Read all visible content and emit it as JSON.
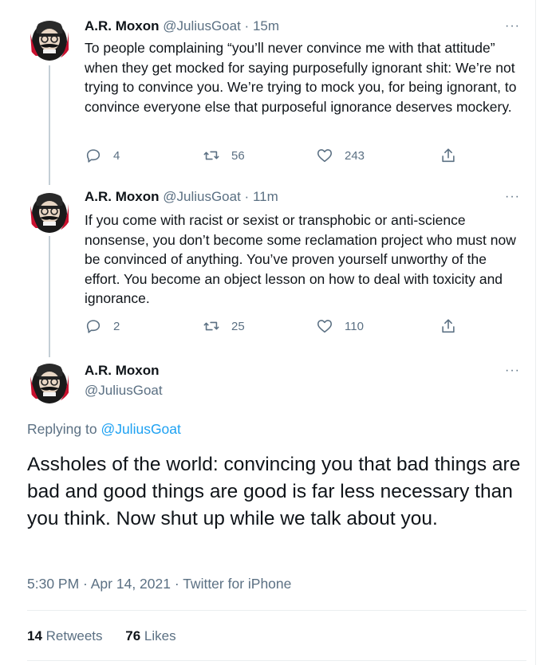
{
  "thread": [
    {
      "name": "A.R. Moxon",
      "handle": "@JuliusGoat",
      "time": "15m",
      "more": "···",
      "text": "To people complaining “you’ll never convince me with that attitude” when they get mocked for saying purposefully ignorant shit: We’re not trying to convince you. We’re trying to mock you, for being ignorant, to convince everyone else that purposeful ignorance deserves mockery.",
      "replies": "4",
      "retweets": "56",
      "likes": "243"
    },
    {
      "name": "A.R. Moxon",
      "handle": "@JuliusGoat",
      "time": "11m",
      "more": "···",
      "text": "If you come with racist or sexist or transphobic or anti-science nonsense, you don’t become some reclamation project who must now be convinced of anything. You’ve proven yourself unworthy of the effort. You become an object lesson on how to deal with toxicity and ignorance.",
      "replies": "2",
      "retweets": "25",
      "likes": "110"
    }
  ],
  "main_tweet": {
    "name": "A.R. Moxon",
    "handle": "@JuliusGoat",
    "more": "···",
    "replying_label": "Replying to",
    "replying_to": "@JuliusGoat",
    "text": "Assholes of the world: convincing you that bad things are bad and good things are good is far less necessary than you think. Now shut up while we talk about you.",
    "timestamp": "5:30 PM · Apr 14, 2021 · Twitter for iPhone",
    "retweets_count": "14",
    "retweets_label": "Retweets",
    "likes_count": "76",
    "likes_label": "Likes"
  },
  "icons": {
    "reply": "reply-icon",
    "retweet": "retweet-icon",
    "like": "heart-icon",
    "share": "share-icon",
    "more": "more-icon"
  },
  "colors": {
    "text": "#0f1419",
    "secondary": "#5b7083",
    "link": "#1da1f2",
    "thread_line": "#c4cfd6",
    "divider": "#ebeef0"
  }
}
